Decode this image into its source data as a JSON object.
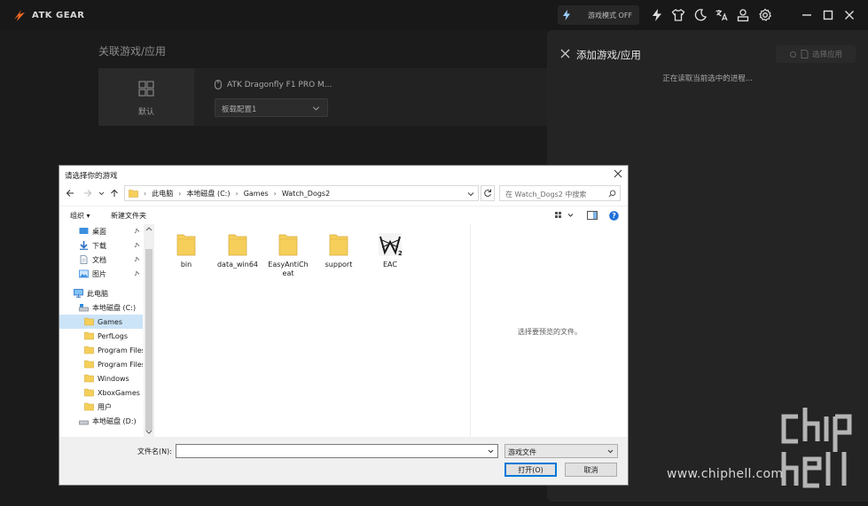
{
  "app": {
    "brand": "ATK GEAR"
  },
  "titlebar": {
    "mode_label": "游戏模式 OFF"
  },
  "main": {
    "section_title": "关联游戏/应用",
    "default_label": "默认",
    "device_name": "ATK Dragonfly F1 PRO M...",
    "profile": "板载配置1"
  },
  "panel": {
    "title": "添加游戏/应用",
    "choose_label": "选择应用",
    "status": "正在读取当前选中的进程..."
  },
  "watermark": {
    "site": "www.chiphell.com"
  },
  "dialog": {
    "title": "请选择你的游戏",
    "breadcrumbs": [
      "此电脑",
      "本地磁盘 (C:)",
      "Games",
      "Watch_Dogs2"
    ],
    "search_placeholder": "在 Watch_Dogs2 中搜索",
    "toolbar": {
      "organize": "组织 ▾",
      "new_folder": "新建文件夹"
    },
    "nav": [
      {
        "label": "桌面",
        "icon": "desktop-icon",
        "pinned": true
      },
      {
        "label": "下载",
        "icon": "download-icon",
        "pinned": true
      },
      {
        "label": "文档",
        "icon": "document-icon",
        "pinned": true
      },
      {
        "label": "图片",
        "icon": "picture-icon",
        "pinned": true
      },
      {
        "label": "此电脑",
        "icon": "computer-icon",
        "pinned": false
      },
      {
        "label": "本地磁盘 (C:)",
        "icon": "drive-icon",
        "pinned": false
      },
      {
        "label": "Games",
        "icon": "folder-icon",
        "pinned": false,
        "selected": true
      },
      {
        "label": "PerfLogs",
        "icon": "folder-icon",
        "pinned": false
      },
      {
        "label": "Program Files",
        "icon": "folder-icon",
        "pinned": false
      },
      {
        "label": "Program Files",
        "icon": "folder-icon",
        "pinned": false
      },
      {
        "label": "Windows",
        "icon": "folder-icon",
        "pinned": false
      },
      {
        "label": "XboxGames",
        "icon": "folder-icon",
        "pinned": false
      },
      {
        "label": "用户",
        "icon": "folder-icon",
        "pinned": false
      },
      {
        "label": "本地磁盘 (D:)",
        "icon": "drive-icon",
        "pinned": false
      }
    ],
    "files": [
      {
        "name": "bin",
        "type": "folder"
      },
      {
        "name": "data_win64",
        "type": "folder"
      },
      {
        "name": "EasyAntiCheat",
        "type": "folder"
      },
      {
        "name": "support",
        "type": "folder"
      },
      {
        "name": "EAC",
        "type": "exe"
      }
    ],
    "preview_text": "选择要预览的文件。",
    "filename_label": "文件名(N):",
    "filename_value": "",
    "filetype": "游戏文件",
    "open_label": "打开(O)",
    "cancel_label": "取消"
  }
}
